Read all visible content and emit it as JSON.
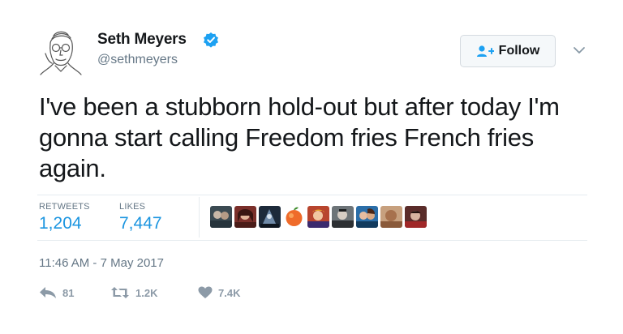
{
  "tweet": {
    "author": {
      "name": "Seth Meyers",
      "handle": "@sethmeyers",
      "verified": true
    },
    "follow_label": "Follow",
    "text": "I've been a stubborn hold-out but after today I'm gonna start calling Freedom fries French fries again.",
    "stats": {
      "retweets_label": "RETWEETS",
      "retweets": "1,204",
      "likes_label": "LIKES",
      "likes": "7,447"
    },
    "timestamp": "11:46 AM - 7 May 2017",
    "actions": {
      "reply_count": "81",
      "retweet_count": "1.2K",
      "like_count": "7.4K"
    }
  },
  "colors": {
    "link_blue": "#1b95e0",
    "verified_blue": "#1da1f2",
    "muted_gray": "#657786",
    "action_gray": "#8c9aa7"
  },
  "icons": [
    "avatar-sketch",
    "verified-badge-icon",
    "add-user-icon",
    "chevron-down-icon",
    "reply-icon",
    "retweet-icon",
    "heart-icon"
  ]
}
